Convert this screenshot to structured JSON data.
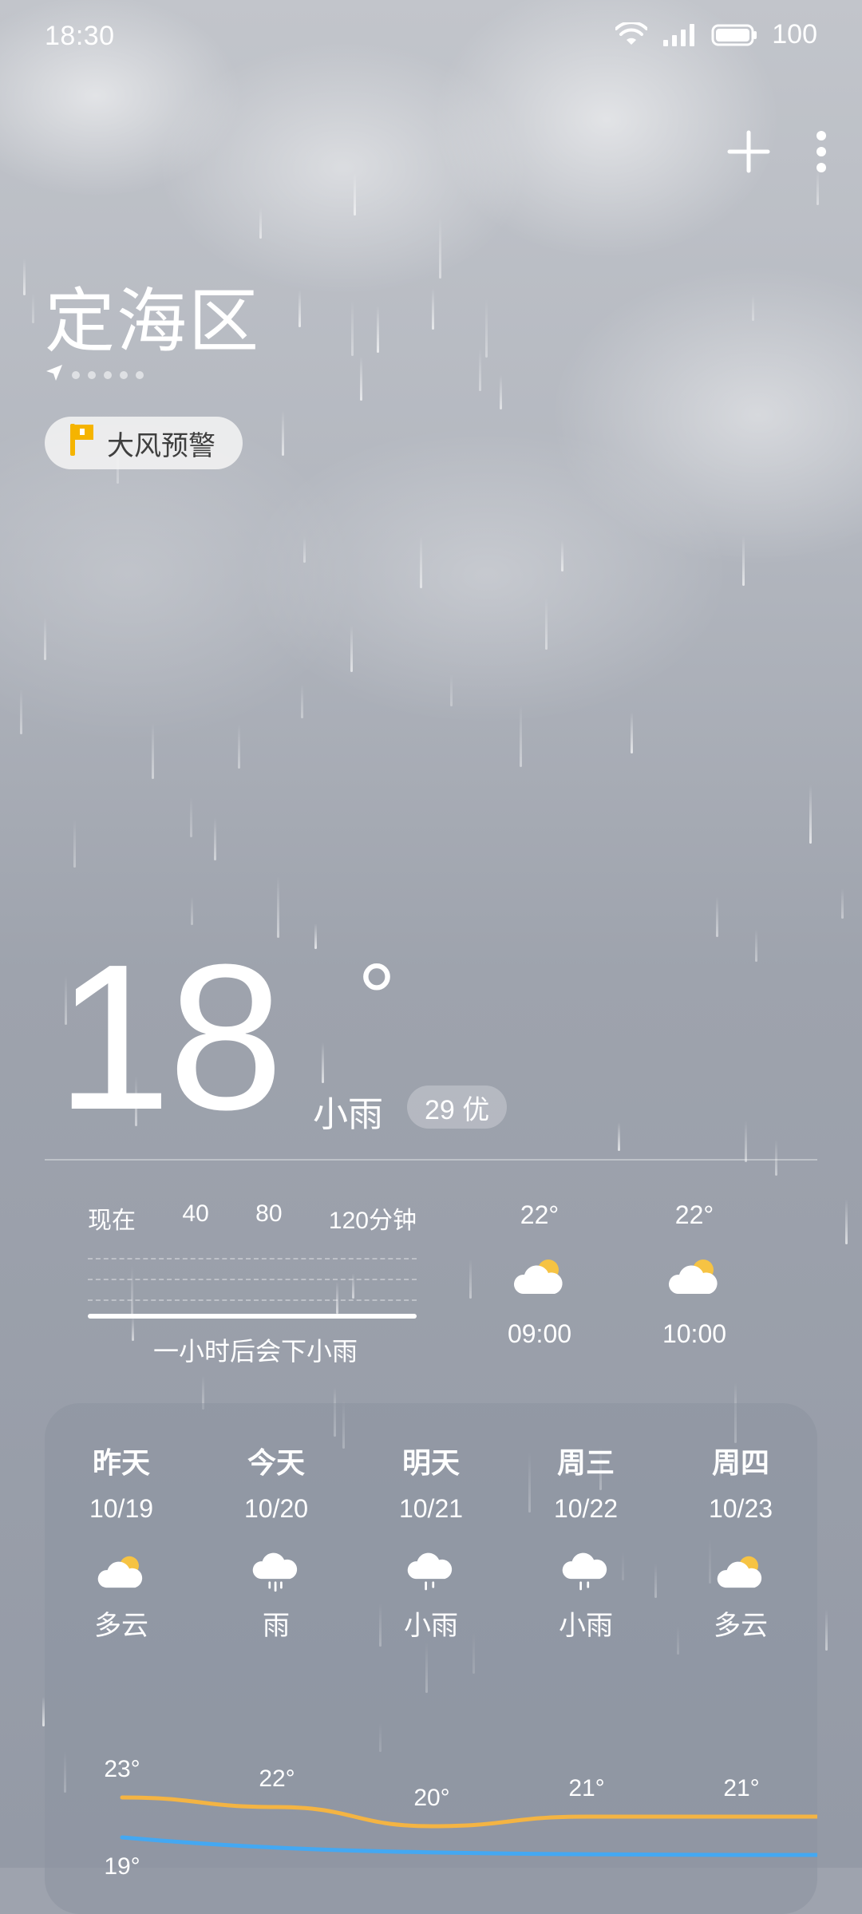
{
  "status_bar": {
    "time": "18:30",
    "battery": "100",
    "icons": [
      "wifi-icon",
      "signal-icon",
      "battery-icon"
    ]
  },
  "header": {
    "add_icon": "plus-icon",
    "more_icon": "more-vertical-icon",
    "location": "定海区",
    "location_icon": "location-arrow-icon",
    "page_dots": 5
  },
  "alert": {
    "label": "大风预警",
    "icon": "warning-flag-icon",
    "icon_color": "#f5b400"
  },
  "current": {
    "temperature": "18",
    "degree": "°",
    "condition": "小雨",
    "aqi": "29 优"
  },
  "precipitation": {
    "labels": [
      "现在",
      "40",
      "80",
      "120分钟"
    ],
    "summary": "一小时后会下小雨"
  },
  "hourly": [
    {
      "temp": "22°",
      "icon": "partly-cloudy-icon",
      "time": "09:00"
    },
    {
      "temp": "22°",
      "icon": "partly-cloudy-icon",
      "time": "10:00"
    }
  ],
  "forecast": [
    {
      "day": "昨天",
      "date": "10/19",
      "icon": "partly-cloudy-icon",
      "condition": "多云"
    },
    {
      "day": "今天",
      "date": "10/20",
      "icon": "rain-cloud-icon",
      "condition": "雨"
    },
    {
      "day": "明天",
      "date": "10/21",
      "icon": "rain-cloud-icon",
      "condition": "小雨"
    },
    {
      "day": "周三",
      "date": "10/22",
      "icon": "rain-cloud-icon",
      "condition": "小雨"
    },
    {
      "day": "周四",
      "date": "10/23",
      "icon": "partly-cloudy-icon",
      "condition": "多云"
    }
  ],
  "trend": {
    "high_labels": [
      "23°",
      "22°",
      "20°",
      "21°",
      "21°"
    ],
    "high_values": [
      23,
      22,
      20,
      21,
      21
    ],
    "low_labels": [
      "19°"
    ],
    "low_value_first": 19,
    "high_color": "#f4b443",
    "low_color": "#44a8f2"
  }
}
